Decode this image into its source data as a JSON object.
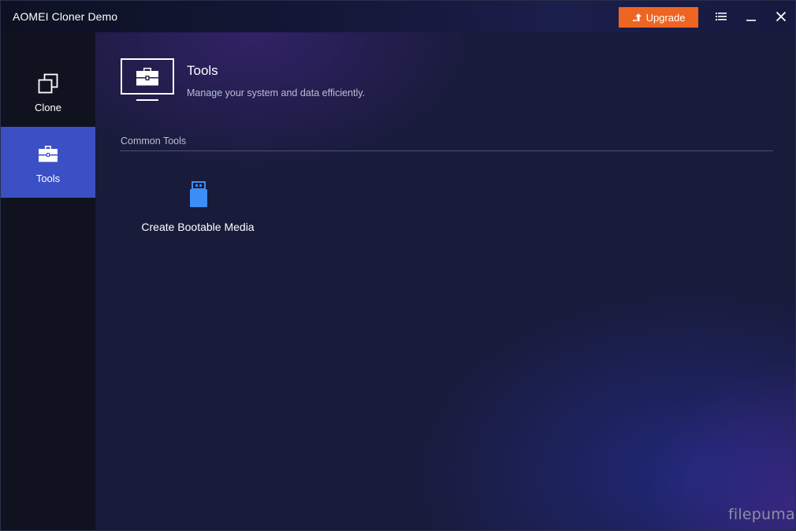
{
  "window": {
    "title": "AOMEI Cloner Demo",
    "upgrade_label": "Upgrade"
  },
  "sidebar": {
    "items": [
      {
        "label": "Clone",
        "icon": "clone-icon",
        "active": false
      },
      {
        "label": "Tools",
        "icon": "toolbox-icon",
        "active": true
      }
    ]
  },
  "main": {
    "title": "Tools",
    "subtitle": "Manage your system and data efficiently.",
    "section_label": "Common Tools",
    "tools": [
      {
        "label": "Create Bootable Media",
        "icon": "usb-drive-icon"
      }
    ]
  },
  "watermark": "filepuma",
  "colors": {
    "accent_orange": "#ee6523",
    "active_sidebar": "#3b50c4",
    "usb_blue": "#3d8ef7"
  }
}
